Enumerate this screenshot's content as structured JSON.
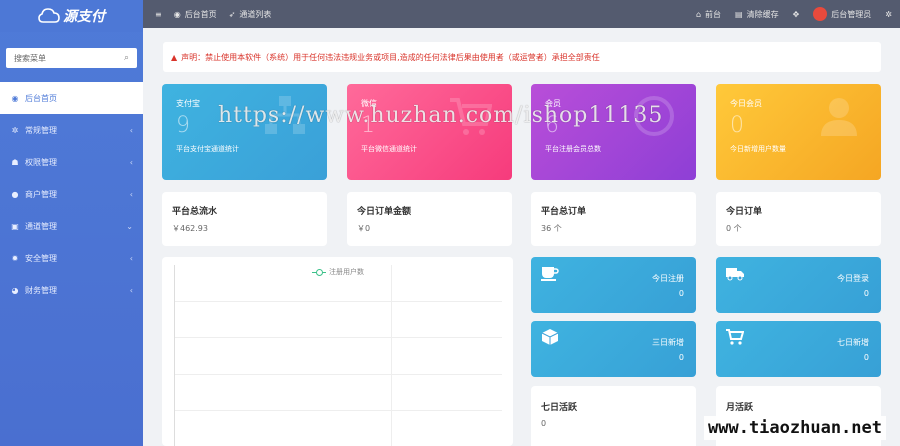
{
  "brand": {
    "logo_text": "源支付",
    "logo_icon": "cloud-logo-icon"
  },
  "sidebar": {
    "search_placeholder": "搜索菜单",
    "items": [
      {
        "label": "后台首页",
        "icon": "dashboard-icon",
        "active": true
      },
      {
        "label": "常规管理",
        "icon": "cogs-icon"
      },
      {
        "label": "权限管理",
        "icon": "group-icon"
      },
      {
        "label": "商户管理",
        "icon": "user-icon"
      },
      {
        "label": "通道管理",
        "icon": "channel-icon"
      },
      {
        "label": "安全管理",
        "icon": "gear-icon"
      },
      {
        "label": "财务管理",
        "icon": "pie-icon"
      }
    ]
  },
  "topbar": {
    "menu_icon": "≡",
    "home_tab": "后台首页",
    "channel_tab": "通道列表",
    "frontend": "前台",
    "clear_cache": "清除缓存",
    "admin": "后台管理员"
  },
  "notice": {
    "text": "声明：禁止使用本软件（系统）用于任何违法违规业务或项目,造成的任何法律后果由使用者（或运营者）承担全部责任"
  },
  "stats": [
    {
      "label": "支付宝",
      "value": "9",
      "desc": "平台支付宝通道统计"
    },
    {
      "label": "微信",
      "value": "1",
      "desc": "平台微信通道统计"
    },
    {
      "label": "会员",
      "value": "6",
      "desc": "平台注册会员总数"
    },
    {
      "label": "今日会员",
      "value": "0",
      "desc": "今日新增用户数量"
    }
  ],
  "totals": [
    {
      "label": "平台总流水",
      "value": "￥462.93"
    },
    {
      "label": "今日订单金额",
      "value": "￥0"
    },
    {
      "label": "平台总订单",
      "value": "36 个"
    },
    {
      "label": "今日订单",
      "value": "0 个"
    }
  ],
  "chart": {
    "legend": "注册用户数"
  },
  "chart_data": {
    "type": "line",
    "series": [
      {
        "name": "注册用户数",
        "values": []
      }
    ],
    "grid": true,
    "legend_position": "top"
  },
  "mini": [
    {
      "label": "今日注册",
      "value": "0",
      "icon": "coffee-cup-icon"
    },
    {
      "label": "今日登录",
      "value": "0",
      "icon": "truck-icon"
    },
    {
      "label": "三日新增",
      "value": "0",
      "icon": "cube-icon"
    },
    {
      "label": "七日新增",
      "value": "0",
      "icon": "cart-icon"
    }
  ],
  "activity": [
    {
      "label": "七日活跃",
      "value": "0"
    },
    {
      "label": "月活跃",
      "value": ""
    }
  ],
  "watermarks": {
    "center": "https://www.huzhan.com/ishop11135",
    "corner": "www.tiaozhuan.net"
  },
  "colors": {
    "sidebar": "#4f7bd8",
    "topbar": "#545b6f",
    "alipay": "#3aa0d8",
    "wechat": "#f63b7c",
    "member": "#8e3fd6",
    "today_member": "#f5a623",
    "notice": "#d9342b"
  }
}
